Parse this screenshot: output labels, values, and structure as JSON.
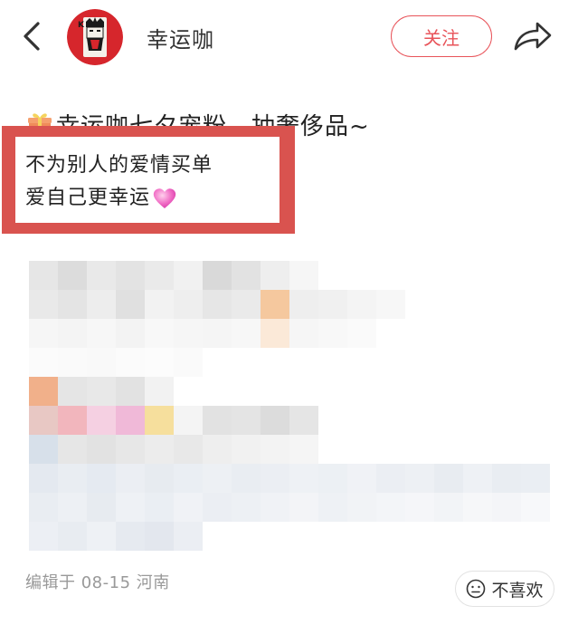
{
  "header": {
    "account_name": "幸运咖",
    "follow_label": "关注",
    "icons": {
      "back": "chevron-left-icon",
      "share": "share-arrow-icon",
      "avatar": "playing-card-king-avatar"
    }
  },
  "post": {
    "title": "幸运咖七夕宠粉，抽奢侈品~",
    "title_icon": "gift-emoji-icon",
    "highlight_lines": [
      "不为别人的爱情买单",
      "爱自己更幸运"
    ],
    "highlight_icon": "pink-heart-emoji-icon",
    "meta": "编辑于 08-15 河南",
    "dislike_label": "不喜欢",
    "dislike_icon": "neutral-face-icon",
    "blurred_content": true
  },
  "colors": {
    "accent": "#e8545a",
    "highlight_frame": "#d9534f",
    "meta_text": "#999999"
  }
}
